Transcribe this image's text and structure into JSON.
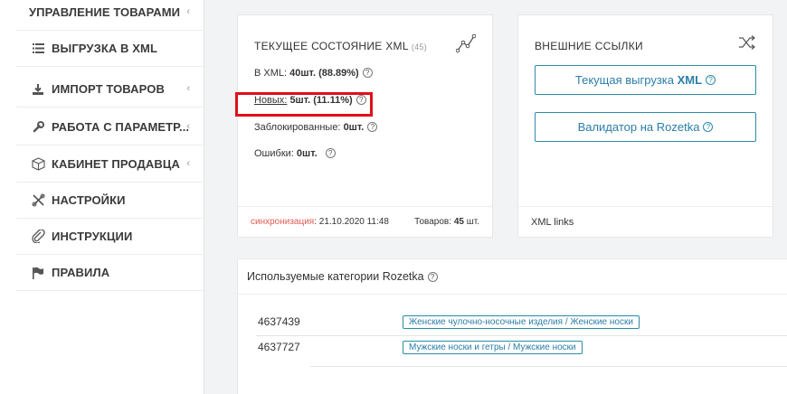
{
  "sidebar": {
    "items": [
      {
        "label": "УПРАВЛЕНИЕ ТОВАРАМИ",
        "icon": "none",
        "chevron": "‹"
      },
      {
        "label": "ВЫГРУЗКА В XML",
        "icon": "list-icon",
        "chevron": ""
      },
      {
        "label": "ИМПОРТ ТОВАРОВ",
        "icon": "download-icon",
        "chevron": "‹"
      },
      {
        "label": "РАБОТА С ПАРАМЕТР...",
        "icon": "wrench-icon",
        "chevron": "‹"
      },
      {
        "label": "КАБИНЕТ ПРОДАВЦА",
        "icon": "cube-icon",
        "chevron": "‹"
      },
      {
        "label": "НАСТРОЙКИ",
        "icon": "tools-icon",
        "chevron": ""
      },
      {
        "label": "ИНСТРУКЦИИ",
        "icon": "paperclip-icon",
        "chevron": ""
      },
      {
        "label": "ПРАВИЛА",
        "icon": "flag-icon",
        "chevron": ""
      }
    ]
  },
  "status_card": {
    "title": "ТЕКУЩЕЕ СОСТОЯНИЕ XML",
    "count": "(45)",
    "in_xml_label": "В XML:",
    "in_xml_value": "40шт. (88.89%)",
    "new_label": "Новых:",
    "new_value": "5шт. (11.11%)",
    "blocked_label": "Заблокированные:",
    "blocked_value": "0шт.",
    "errors_label": "Ошибки:",
    "errors_value": "0шт.",
    "sync_label": "синхронизация",
    "sync_time": ": 21.10.2020 11:48",
    "products_label": "Товаров:",
    "products_value": "45",
    "products_unit": "шт."
  },
  "links_card": {
    "title": "ВНЕШНИЕ ССЫЛКИ",
    "btn_xml_prefix": "Текущая выгрузка ",
    "btn_xml_bold": "XML",
    "btn_validator": "Валидатор на Rozetka",
    "footer": "XML links"
  },
  "categories_card": {
    "title": "Используемые категории Rozetka",
    "rows": [
      {
        "id": "4637439",
        "category": "Женские чулочно-носочные изделия / Женские носки"
      },
      {
        "id": "4637727",
        "category": "Мужские носки и гетры / Мужские носки"
      }
    ]
  },
  "colors": {
    "accent": "#2a7ea8",
    "sync": "#e05a4e",
    "highlight": "#e0101a"
  }
}
